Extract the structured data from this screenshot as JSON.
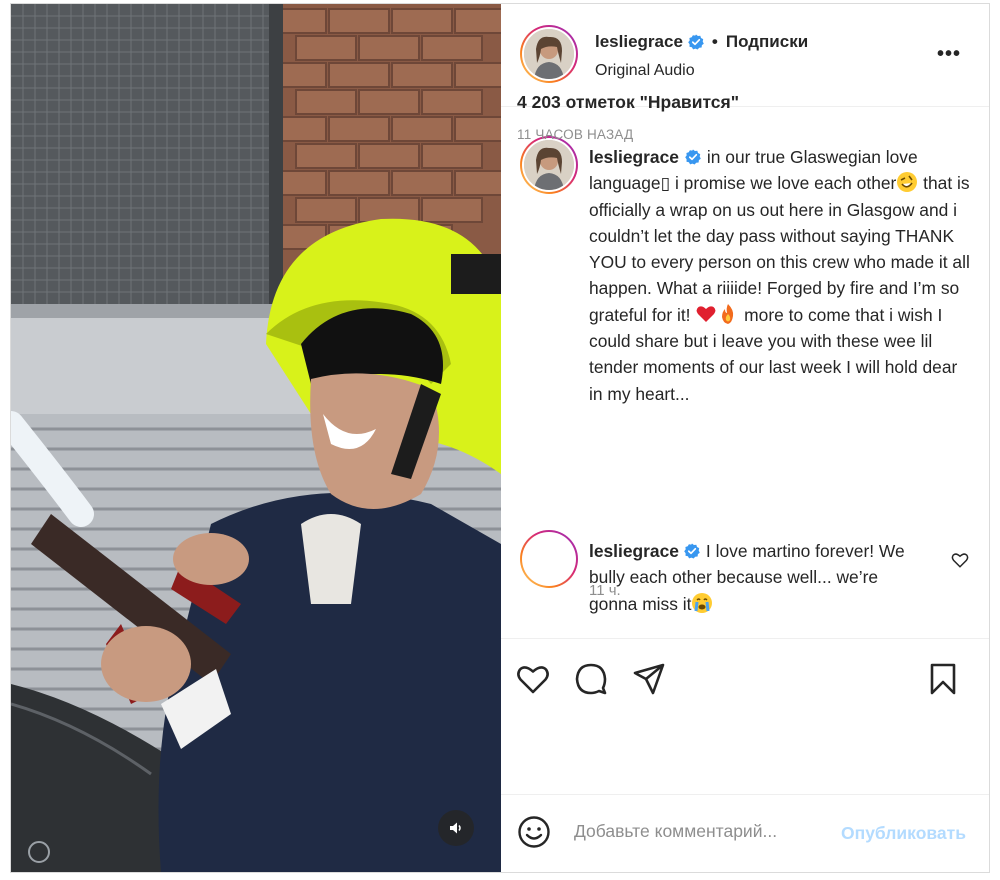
{
  "post": {
    "username": "lesliegrace",
    "separator": "•",
    "follow_label": "Подписки",
    "audio_label": "Original Audio",
    "more_label": "•••",
    "caption_text": "in our true Glaswegian love language▯ i promise we love each other",
    "caption_text_2": " that is officially a wrap on us out here in Glasgow and i couldn’t let the day pass without saying THANK YOU to every person on this crew who made it all happen. What a riiiide! Forged by fire and I’m so grateful for it! ",
    "caption_text_3": " more to come that i wish I could share but i leave you with these wee lil tender moments of our last week I will hold dear in my heart...",
    "caption_time": "11 ч.",
    "comment_text": "I love martino forever! We bully each other because well... we’re gonna miss it",
    "likes": "4 203 отметок \"Нравится\"",
    "time_ago": "11 ЧАСОВ НАЗАД",
    "comment_placeholder": "Добавьте комментарий...",
    "publish_label": "Опубликовать"
  },
  "icons": {
    "verified": "verified-badge-icon",
    "like": "heart-outline-icon",
    "comment": "speech-bubble-icon",
    "share": "paper-plane-icon",
    "save": "bookmark-icon",
    "emoji": "smiley-icon",
    "sound": "speaker-icon",
    "options": "more-horizontal-icon"
  },
  "colors": {
    "accent_blue": "#0095f6",
    "publish_disabled": "#b3dbff",
    "muted_text": "#8e8e8e",
    "border": "#dbdbdb",
    "helmet_yellow": "#d8f21a"
  }
}
